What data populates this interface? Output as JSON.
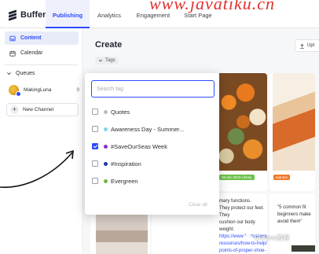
{
  "watermark": "www.javatiku.cn",
  "nav": {
    "logo_text": "Buffer",
    "tabs": [
      {
        "label": "Publishing",
        "active": true
      },
      {
        "label": "Analytics",
        "active": false
      },
      {
        "label": "Engagement",
        "active": false
      },
      {
        "label": "Start Page",
        "active": false
      }
    ]
  },
  "sidebar": {
    "items": [
      {
        "label": "Content",
        "icon": "inbox-icon",
        "active": true
      },
      {
        "label": "Calendar",
        "icon": "calendar-icon",
        "active": false
      }
    ],
    "queues_label": "Queues",
    "channel": {
      "name": "MakingLuna",
      "count": "0"
    },
    "new_channel_label": "New Channel"
  },
  "main": {
    "title": "Create",
    "tags_button": "Tags",
    "upload_button": "Upl",
    "cards": [
      {
        "tag": "Winter 2023 Lifesty",
        "tag_color": "#6bc04b"
      },
      {
        "tag": "autumn",
        "tag_color": "#f07a2a"
      }
    ],
    "card_text_1": {
      "line1": "mary functions.",
      "line2": "They protect our feet. They",
      "line3": "cushion our body weight:",
      "link1": "https://www.footcaremd.org/",
      "link2": "resources/how-to-help/",
      "link3": "points-of-proper-shoe-fit"
    },
    "card_text_2": {
      "line1": "\"5 common fit",
      "line2": "beginners make",
      "line3": "avoid them\""
    }
  },
  "tag_dropdown": {
    "search_placeholder": "Search tag",
    "options": [
      {
        "label": "Quotes",
        "color": "#b9bcc3",
        "checked": false
      },
      {
        "label": "Awareness Day - Summer...",
        "color": "#7fd6e6",
        "checked": false
      },
      {
        "label": "#SaveOurSeas Week",
        "color": "#8a2fc4",
        "checked": true
      },
      {
        "label": "#Inspiration",
        "color": "#1f3aa8",
        "checked": false
      },
      {
        "label": "Evergreen",
        "color": "#6fb83d",
        "checked": false
      }
    ],
    "clear_all": "Clear all"
  },
  "overlay_badge": "Chrome教程",
  "colors": {
    "accent": "#2c4bff",
    "active_bg": "#e8ecf9"
  }
}
